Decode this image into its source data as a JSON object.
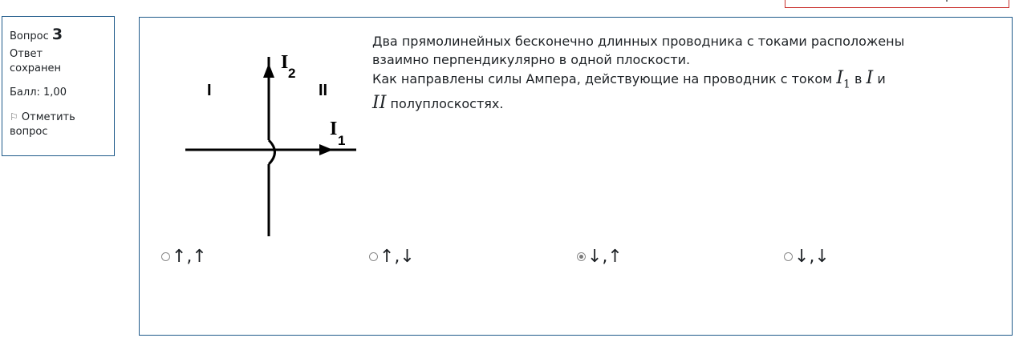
{
  "top_bar": {
    "partial_text": "р"
  },
  "info": {
    "question_label": "Вопрос",
    "question_number": "3",
    "state": "Ответ сохранен",
    "grade": "Балл: 1,00",
    "flag_icon": "flag-outline-icon",
    "flag_label": "Отметить вопрос"
  },
  "diagram": {
    "region_1_label": "I",
    "region_2_label": "II",
    "current_1_label": "I",
    "current_1_sub": "1",
    "current_2_label": "I",
    "current_2_sub": "2"
  },
  "question": {
    "line1": "Два прямолинейных бесконечно длинных проводника с токами расположены",
    "line2": "взаимно перпендикулярно в одной плоскости.",
    "line3_prefix": "Как направлены силы Ампера, действующие на проводник с током ",
    "math_I": "I",
    "math_sub_1": "1",
    "word_v": " в ",
    "math_region_I": "I",
    "word_i": " и",
    "math_region_II": "II",
    "line4_suffix": " полуплоскостях."
  },
  "options": [
    {
      "label": "↑,↑",
      "selected": false
    },
    {
      "label": "↑,↓",
      "selected": false
    },
    {
      "label": "↓,↑",
      "selected": true
    },
    {
      "label": "↓,↓",
      "selected": false
    }
  ]
}
